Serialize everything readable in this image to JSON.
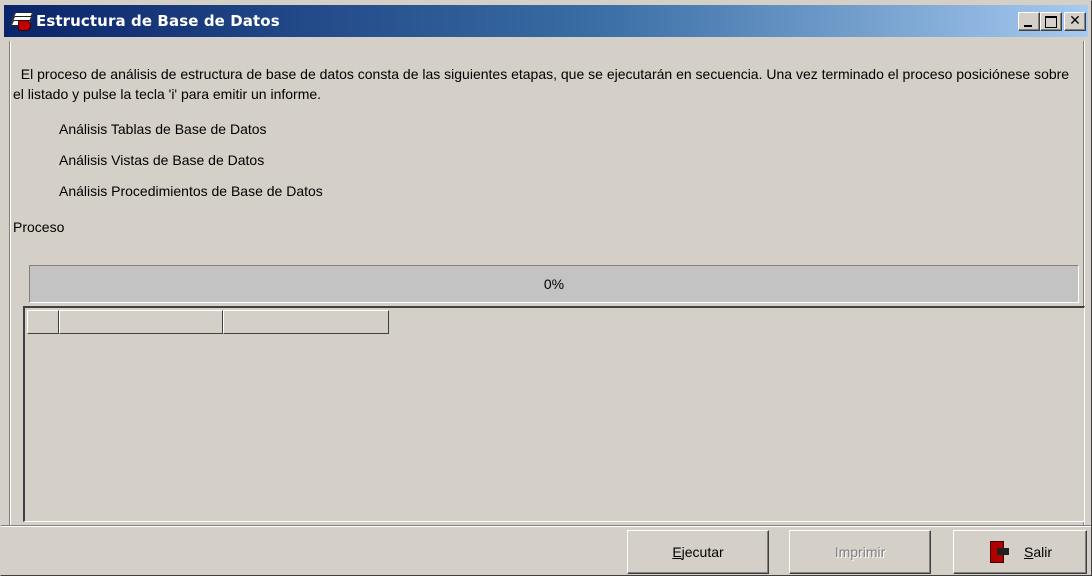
{
  "window": {
    "title": "Estructura de Base de Datos",
    "title_buttons": {
      "minimize": "_",
      "maximize": "□",
      "close": "✕"
    },
    "colors": {
      "titlebar_start": "#0a246a",
      "titlebar_end": "#a6caf0",
      "face": "#d4d0c8"
    }
  },
  "description": "  El proceso de análisis de estructura de base de datos consta de las siguientes etapas, que se ejecutarán en secuencia. Una vez terminado el proceso posiciónese sobre el listado y pulse la tecla 'i' para emitir un informe.",
  "steps": [
    "Análisis Tablas de Base de Datos",
    "Análisis Vistas de Base de Datos",
    "Análisis Procedimientos de Base de Datos"
  ],
  "process_label": "Proceso",
  "progress": {
    "text": "0%",
    "value": 0
  },
  "grid": {
    "columns": [
      "",
      "",
      ""
    ],
    "rows": []
  },
  "buttons": {
    "ejecutar": {
      "mnemonic": "E",
      "rest": "jecutar"
    },
    "imprimir": {
      "label": "Imprimir",
      "enabled": false
    },
    "salir": {
      "mnemonic": "S",
      "rest": "alir",
      "icon": "exit-door-icon"
    }
  }
}
